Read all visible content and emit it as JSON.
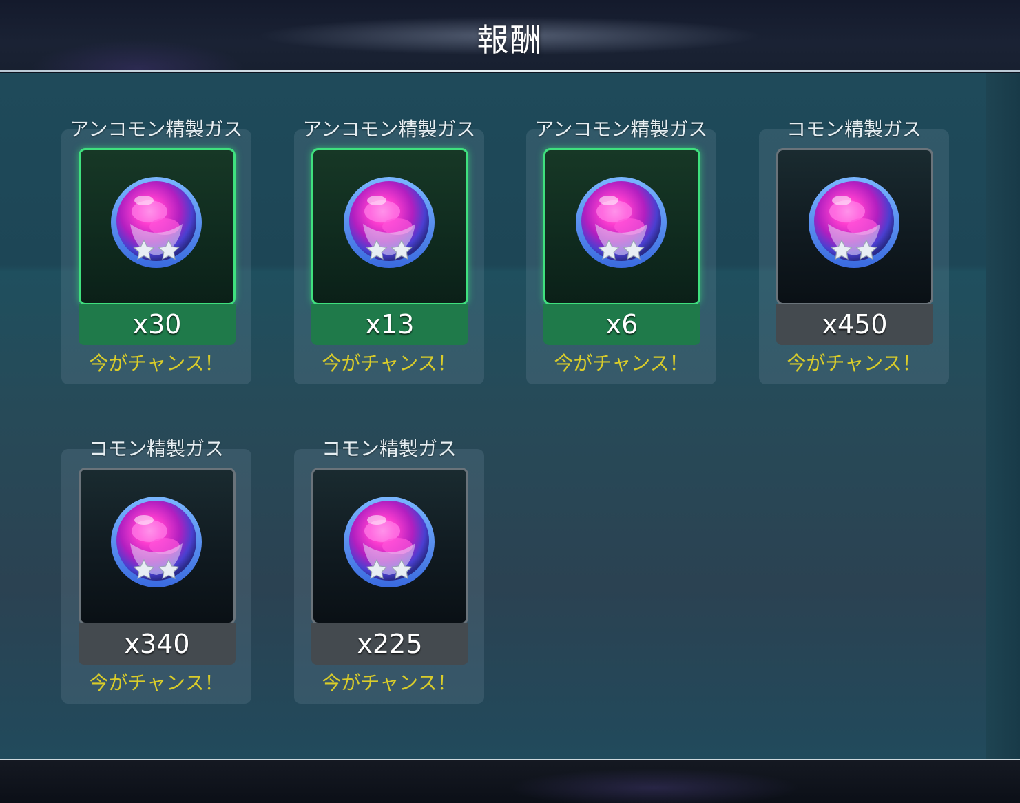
{
  "header": {
    "title": "報酬"
  },
  "rewards": [
    {
      "name": "アンコモン精製ガス",
      "quantity": "x30",
      "note": "今がチャンス！",
      "rarity": "uncommon",
      "icon": "refined-gas-icon",
      "stars": 2
    },
    {
      "name": "アンコモン精製ガス",
      "quantity": "x13",
      "note": "今がチャンス！",
      "rarity": "uncommon",
      "icon": "refined-gas-icon",
      "stars": 2
    },
    {
      "name": "アンコモン精製ガス",
      "quantity": "x6",
      "note": "今がチャンス！",
      "rarity": "uncommon",
      "icon": "refined-gas-icon",
      "stars": 2
    },
    {
      "name": "コモン精製ガス",
      "quantity": "x450",
      "note": "今がチャンス！",
      "rarity": "common",
      "icon": "refined-gas-icon",
      "stars": 2
    },
    {
      "name": "コモン精製ガス",
      "quantity": "x340",
      "note": "今がチャンス！",
      "rarity": "common",
      "icon": "refined-gas-icon",
      "stars": 2
    },
    {
      "name": "コモン精製ガス",
      "quantity": "x225",
      "note": "今がチャンス！",
      "rarity": "common",
      "icon": "refined-gas-icon",
      "stars": 2
    }
  ],
  "colors": {
    "uncommon_border": "#3fe07e",
    "uncommon_quantity_bg": "#1f7a4a",
    "common_quantity_bg": "#444a4f",
    "note_text": "#d9cc2a"
  }
}
